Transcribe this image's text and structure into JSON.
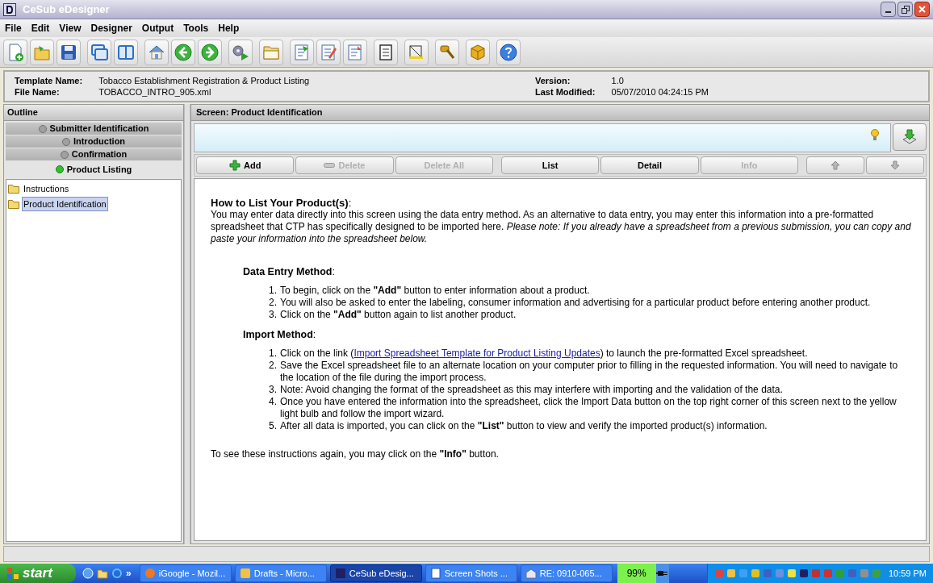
{
  "window": {
    "title": "CeSub eDesigner"
  },
  "menu": [
    "File",
    "Edit",
    "View",
    "Designer",
    "Output",
    "Tools",
    "Help"
  ],
  "info": {
    "template_label": "Template Name:",
    "template_value": "Tobacco Establishment Registration & Product Listing",
    "file_label": "File Name:",
    "file_value": "TOBACCO_INTRO_905.xml",
    "version_label": "Version:",
    "version_value": "1.0",
    "modified_label": "Last Modified:",
    "modified_value": "05/07/2010 04:24:15 PM"
  },
  "outline": {
    "title": "Outline",
    "sections": [
      {
        "label": "Submitter Identification",
        "selected": false
      },
      {
        "label": "Introduction",
        "selected": false
      },
      {
        "label": "Confirmation",
        "selected": false
      },
      {
        "label": "Product Listing",
        "selected": true
      }
    ],
    "tree": [
      {
        "label": "Instructions",
        "selected": false
      },
      {
        "label": "Product Identification",
        "selected": true
      }
    ]
  },
  "screen": {
    "title": "Screen: Product Identification",
    "buttons": [
      {
        "kind": "add",
        "label": "Add",
        "disabled": false
      },
      {
        "kind": "delete",
        "label": "Delete",
        "disabled": true
      },
      {
        "kind": "text",
        "label": "Delete All",
        "disabled": true
      },
      {
        "kind": "text",
        "label": "List",
        "disabled": false
      },
      {
        "kind": "text",
        "label": "Detail",
        "disabled": false
      },
      {
        "kind": "text",
        "label": "Info",
        "disabled": true
      },
      {
        "kind": "up",
        "disabled": false
      },
      {
        "kind": "down",
        "disabled": false
      }
    ],
    "heading": "**How to List Your Product(s)**:",
    "intro": "You may enter data directly into this screen using the data entry method. As an alternative to data entry, you may enter this information into a pre-formatted spreadsheet that CTP has specifically designed to be imported here. *Please note: If you already have a spreadsheet from a previous submission, you can copy and paste your information into the spreadsheet below.*",
    "sections": [
      {
        "title": "**Data Entry Method**:",
        "steps": [
          {
            "number": "1.",
            "text": "To begin, click on the **\"Add\"** button to enter information about a product."
          },
          {
            "number": "2.",
            "text": "You will also be asked to enter the labeling, consumer information and advertising for a particular product before entering another product."
          },
          {
            "number": "3.",
            "text": "Click on the **\"Add\"** button again to list another product."
          }
        ]
      },
      {
        "title": "**Import Method**:",
        "steps": [
          {
            "number": "1.",
            "text": "Click on the link (",
            "link": "Import Spreadsheet Template for Product Listing Updates",
            "after": ") to launch the pre-formatted Excel spreadsheet."
          },
          {
            "number": "2.",
            "text": "Save the Excel spreadsheet file to an alternate location on your computer prior to filling in the requested information. You will need to navigate to the location of the file during the import process."
          },
          {
            "number": "3.",
            "text": "Note: Avoid changing the format of the spreadsheet as this may interfere with importing and the validation of the data."
          },
          {
            "number": "4.",
            "text": "Once you have entered the information into the spreadsheet, click the Import Data button on the top right corner of this screen next to the yellow light bulb and follow the import wizard."
          },
          {
            "number": "5.",
            "text": "After all data is imported, you can click on the **\"List\"** button to view and verify the imported product(s) information."
          }
        ]
      }
    ],
    "footer": "To see these instructions again, you may click on the **\"Info\"** button."
  },
  "taskbar": {
    "start": "start",
    "items": [
      {
        "label": "iGoogle - Mozil...",
        "selected": false
      },
      {
        "label": "Drafts - Micro...",
        "selected": false
      },
      {
        "label": "CeSub eDesig...",
        "selected": true
      },
      {
        "label": "Screen Shots ...",
        "selected": false
      },
      {
        "label": "RE: 0910-065...",
        "selected": false
      }
    ],
    "battery": "99%",
    "overflow": "»",
    "clock": "10:59 PM"
  }
}
